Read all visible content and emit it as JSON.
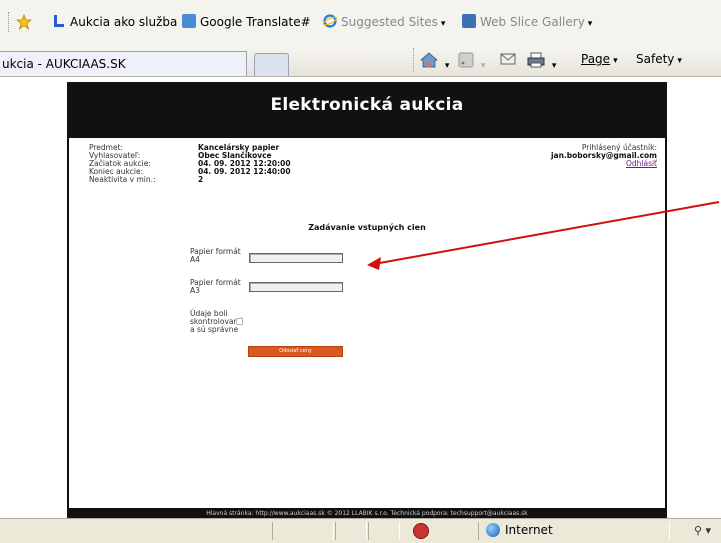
{
  "favorites": {
    "items": [
      {
        "label": "Aukcia ako služba",
        "icon": "blue-l-favicon"
      },
      {
        "label": "Google Translate#",
        "icon": "google-translate-icon"
      },
      {
        "label": "Suggested Sites",
        "icon": "ie-logo-icon",
        "dropdown": "▾"
      },
      {
        "label": "Web Slice Gallery",
        "icon": "web-slice-icon",
        "dropdown": "▾"
      }
    ]
  },
  "tab": {
    "title": "ukcia - AUKCIAAS.SK"
  },
  "command_bar": {
    "page_label": "Page",
    "safety_label": "Safety",
    "dropdown": "▾"
  },
  "page": {
    "title": "Elektronická aukcia",
    "info_labels": [
      "Predmet:",
      "Vyhlasovateľ:",
      "Začiatok aukcie:",
      "Koniec aukcie:",
      "Neaktivita v min.:"
    ],
    "info_values": [
      "Kancelársky papier",
      "Obec Slančíkovce",
      "04. 09. 2012 12:20:00",
      "04. 09. 2012 12:40:00",
      "2"
    ],
    "user": {
      "label": "Prihlásený účastník:",
      "email": "jan.boborsky@gmail.com",
      "logout": "Odhlásiť"
    },
    "form": {
      "title": "Zadávanie vstupných cien",
      "field1": {
        "label_line1": "Papier formát",
        "label_line2": "A4",
        "value": ""
      },
      "field2": {
        "label_line1": "Papier formát",
        "label_line2": "A3",
        "value": ""
      },
      "checkbox": {
        "line1": "Údaje boli",
        "line2": "skontrolované",
        "line3": "a sú správne",
        "checked": false
      },
      "submit_label": "Odoslať ceny"
    },
    "footer": "Hlavná stránka: http://www.aukciaas.sk © 2012 LLABIK s.r.o. Technická podpora: techsupport@aukciaas.sk"
  },
  "annotation": {
    "arrow_color": "#d01010"
  },
  "statusbar": {
    "zone": "Internet",
    "zoom_icon": "zoom-icon"
  }
}
